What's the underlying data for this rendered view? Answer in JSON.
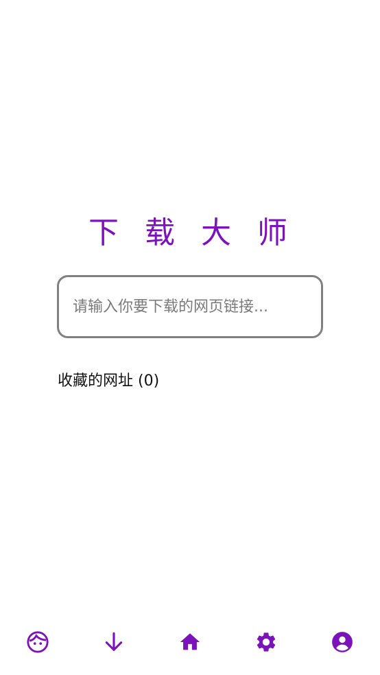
{
  "app": {
    "title": "下 载 大 师",
    "accent_color": "#7a14b8"
  },
  "search": {
    "placeholder": "请输入你要下载的网页链接...",
    "value": ""
  },
  "favorites": {
    "label": "收藏的网址 (0)"
  },
  "bottom_nav": {
    "items": [
      {
        "icon": "face-icon"
      },
      {
        "icon": "download-arrow-icon"
      },
      {
        "icon": "home-icon"
      },
      {
        "icon": "gear-icon"
      },
      {
        "icon": "account-circle-icon"
      }
    ]
  }
}
